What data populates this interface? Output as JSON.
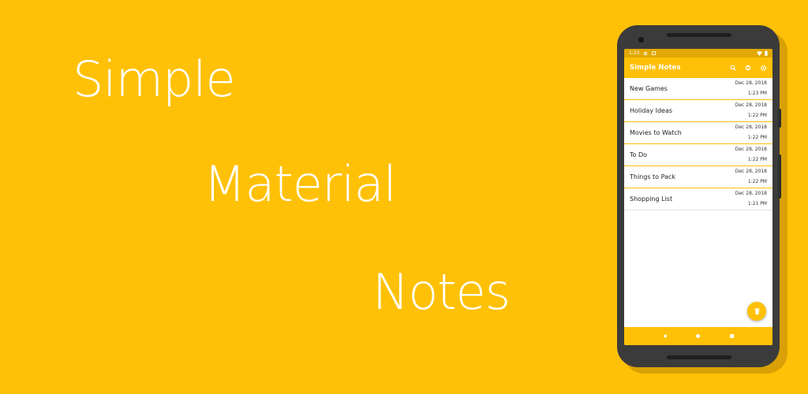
{
  "colors": {
    "background": "#FFC107",
    "status_bar": "#E0A800",
    "accent": "#FFC107",
    "phone_body": "#3B3B3B"
  },
  "headline": {
    "words": [
      "Simple",
      "Material",
      "Notes"
    ]
  },
  "status_bar": {
    "time": "1:23",
    "icons": [
      "gear-icon",
      "square-icon",
      "wifi-icon",
      "battery-icon"
    ]
  },
  "app_bar": {
    "title": "Simple Notes",
    "actions": [
      "search-icon",
      "sync-icon",
      "gear-icon"
    ]
  },
  "notes": [
    {
      "title": "New Games",
      "date": "Dec 28, 2018",
      "time": "1:23 PM"
    },
    {
      "title": "Holiday Ideas",
      "date": "Dec 28, 2018",
      "time": "1:22 PM"
    },
    {
      "title": "Movies to Watch",
      "date": "Dec 28, 2018",
      "time": "1:22 PM"
    },
    {
      "title": "To Do",
      "date": "Dec 28, 2018",
      "time": "1:22 PM"
    },
    {
      "title": "Things to Pack",
      "date": "Dec 28, 2018",
      "time": "1:22 PM"
    },
    {
      "title": "Shopping List",
      "date": "Dec 28, 2018",
      "time": "1:21 PM"
    }
  ],
  "fab": {
    "icon": "trash-icon"
  },
  "nav_bar": {
    "icons": [
      "back-icon",
      "home-icon",
      "recents-icon"
    ]
  }
}
